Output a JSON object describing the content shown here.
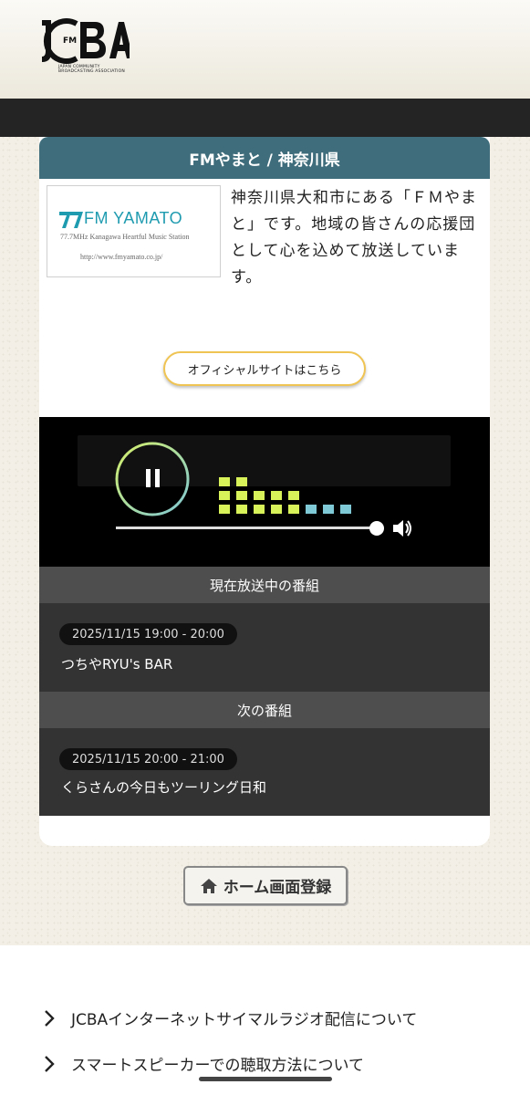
{
  "header": {
    "logo_text": "JCBA",
    "logo_fm": "FM",
    "logo_subtitle": "JAPAN COMMUNITY BROADCASTING ASSOCIATION"
  },
  "station": {
    "title": "FMやまと / 神奈川県",
    "logo": {
      "name": "FM YAMATO",
      "tagline": "77.7MHz Kanagawa Heartful Music Station",
      "url": "http://www.fmyamato.co.jp/"
    },
    "description": "神奈川県大和市にある「ＦＭやまと」です。地域の皆さんの応援団として心を込めて放送しています。",
    "official_button": "オフィシャルサイトはこちら"
  },
  "player": {
    "state": "playing",
    "volume_fraction": 1.0,
    "colors": {
      "ring_start": "#d6f06a",
      "ring_end": "#7fc8d6",
      "eq_yellow": "#d8f25a",
      "eq_blue": "#7fc8d6"
    }
  },
  "now_playing": {
    "header": "現在放送中の番組",
    "time": "2025/11/15 19:00 - 20:00",
    "title": "つちやRYU's BAR"
  },
  "next_program": {
    "header": "次の番組",
    "time": "2025/11/15 20:00 - 21:00",
    "title": "くらさんの今日もツーリング日和"
  },
  "home_button": {
    "label": "ホーム画面登録",
    "icon": "house-icon"
  },
  "footer": {
    "links": [
      {
        "label": "JCBAインターネットサイマルラジオ配信について"
      },
      {
        "label": "スマートスピーカーでの聴取方法について"
      }
    ]
  },
  "theme": {
    "accent": "#3f6d7b",
    "button_border": "#f0c453",
    "dark_bar": "#242424"
  }
}
